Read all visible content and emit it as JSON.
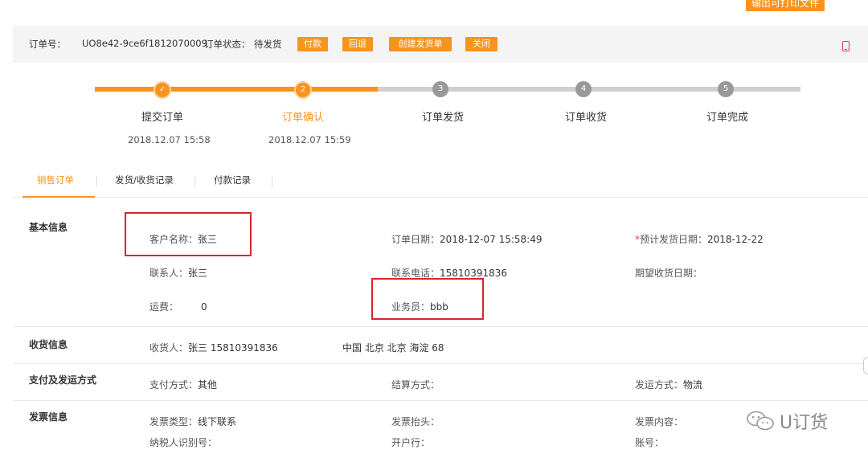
{
  "toolbar": {
    "export_label": "输出可打印文件"
  },
  "order": {
    "number_label": "订单号：",
    "number": "UO8e42-9ce6f1812070009",
    "status_label": "订单状态：",
    "status": "待发货",
    "actions": [
      "付款",
      "回退",
      "创建发货单",
      "关闭"
    ]
  },
  "progress": {
    "steps": [
      {
        "num": "✓",
        "label": "提交订单",
        "time": "2018.12.07 15:58"
      },
      {
        "num": "2",
        "label": "订单确认",
        "time": "2018.12.07 15:59"
      },
      {
        "num": "3",
        "label": "订单发货",
        "time": ""
      },
      {
        "num": "4",
        "label": "订单收货",
        "time": ""
      },
      {
        "num": "5",
        "label": "订单完成",
        "time": ""
      }
    ],
    "completed_steps": 2
  },
  "tabs": [
    "销售订单",
    "发货/收货记录",
    "付款记录"
  ],
  "sections": {
    "basic": {
      "title": "基本信息",
      "customer_k": "客户名称：",
      "customer_v": "张三",
      "order_date_k": "订单日期：",
      "order_date_v": "2018-12-07 15:58:49",
      "ship_date_req": "*",
      "ship_date_k": "预计发货日期：",
      "ship_date_v": "2018-12-22",
      "contact_k": "联系人：",
      "contact_v": "张三",
      "phone_k": "联系电话：",
      "phone_v": "15810391836",
      "receive_date_k": "期望收货日期：",
      "receive_date_v": "",
      "freight_k": "运费：",
      "freight_v": "0",
      "salesman_k": "业务员：",
      "salesman_v": "bbb"
    },
    "receiving": {
      "title": "收货信息",
      "receiver_k": "收货人：",
      "receiver_v": "张三 15810391836",
      "address": "中国 北京 北京 海淀 68"
    },
    "payment": {
      "title": "支付及发运方式",
      "pay_k": "支付方式：",
      "pay_v": "其他",
      "settle_k": "结算方式：",
      "settle_v": "",
      "ship_k": "发运方式：",
      "ship_v": "物流"
    },
    "invoice": {
      "title": "发票信息",
      "type_k": "发票类型：",
      "type_v": "线下联系",
      "header_k": "发票抬头：",
      "header_v": "",
      "content_k": "发票内容：",
      "content_v": "",
      "taxid_k": "纳税人识别号：",
      "taxid_v": "",
      "bank_k": "开户行：",
      "bank_v": "",
      "account_k": "账号：",
      "account_v": ""
    }
  },
  "watermark": {
    "text": "U订货",
    "icon": "wechat-icon"
  },
  "colors": {
    "accent": "#f7941d",
    "highlight": "#d9262c",
    "inactive": "#b5b5b5"
  }
}
